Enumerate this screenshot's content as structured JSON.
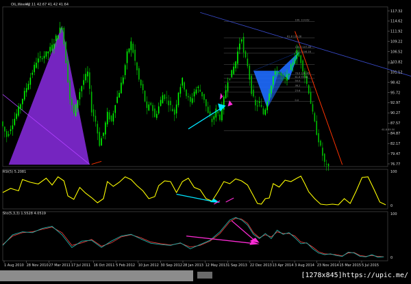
{
  "header": {
    "symbol": "OIL,Weekly",
    "ohlc": "42.11 42.67 41.42 41.64"
  },
  "colors": {
    "background": "#000000",
    "candles_up": "#00ff00",
    "candles_down": "#00c000",
    "rsi_line": "#ffff00",
    "stoch_main": "#20b2aa",
    "stoch_signal": "#ff4040",
    "pattern_blue": "#1e6bff",
    "pattern_purple": "#8a2be2",
    "arrow_cyan": "#00e5ff",
    "arrow_magenta": "#ff2bd6",
    "trend_red": "#ff3300",
    "trend_blue": "#3a4ccf"
  },
  "chart_data": [
    {
      "type": "candlestick",
      "title": "OIL,Weekly",
      "y_ticks": [
        "117.32",
        "114.62",
        "111.92",
        "109.22",
        "106.52",
        "103.82",
        "101.12",
        "98.42",
        "95.72",
        "92.97",
        "90.27",
        "87.57",
        "84.87",
        "82.17",
        "79.47",
        "76.77"
      ],
      "ylim": [
        76.0,
        118.5
      ],
      "fib_levels": [
        "100. 114.62",
        "61.8 110.28",
        "100.0 107.46",
        "127.2 106.16",
        "23.6",
        "78.6 100.46",
        "61.8 99.46",
        "50.0",
        "38.2",
        "23.6",
        "0.0",
        "61.8 85.50"
      ],
      "path_price": [
        [
          0,
          88
        ],
        [
          3,
          84
        ],
        [
          8,
          90
        ],
        [
          13,
          97
        ],
        [
          18,
          104
        ],
        [
          23,
          106
        ],
        [
          26,
          108
        ],
        [
          29,
          111.5
        ],
        [
          31,
          113.5
        ],
        [
          33,
          104
        ],
        [
          35,
          94
        ],
        [
          37,
          90
        ],
        [
          40,
          96
        ],
        [
          42,
          99
        ],
        [
          44,
          101
        ],
        [
          46,
          91
        ],
        [
          48,
          88
        ],
        [
          50,
          82
        ],
        [
          52,
          85
        ],
        [
          54,
          90
        ],
        [
          56,
          88
        ],
        [
          58,
          93
        ],
        [
          60,
          96
        ],
        [
          62,
          100
        ],
        [
          64,
          106
        ],
        [
          66,
          109
        ],
        [
          68,
          104
        ],
        [
          70,
          99
        ],
        [
          72,
          96
        ],
        [
          74,
          91
        ],
        [
          76,
          93
        ],
        [
          78,
          89
        ],
        [
          80,
          92
        ],
        [
          82,
          95
        ],
        [
          84,
          94
        ],
        [
          86,
          92
        ],
        [
          88,
          90
        ],
        [
          90,
          96
        ],
        [
          92,
          99
        ],
        [
          94,
          95
        ],
        [
          96,
          93
        ],
        [
          98,
          96
        ],
        [
          100,
          97
        ],
        [
          103,
          94
        ],
        [
          105,
          90
        ],
        [
          107,
          88
        ],
        [
          109,
          91
        ],
        [
          111,
          89
        ],
        [
          113,
          94
        ],
        [
          115,
          99
        ],
        [
          117,
          101
        ],
        [
          119,
          104
        ],
        [
          121,
          109
        ],
        [
          122,
          110.5
        ],
        [
          123,
          106
        ],
        [
          125,
          103
        ],
        [
          127,
          96
        ],
        [
          129,
          92
        ],
        [
          131,
          93
        ],
        [
          133,
          90
        ],
        [
          134,
          91.5
        ],
        [
          136,
          96
        ],
        [
          138,
          100
        ],
        [
          140,
          101.5
        ],
        [
          142,
          100
        ],
        [
          144,
          99
        ],
        [
          146,
          101
        ],
        [
          148,
          104
        ],
        [
          150,
          106.5
        ],
        [
          152,
          104
        ],
        [
          154,
          100
        ],
        [
          156,
          96
        ],
        [
          158,
          90
        ],
        [
          160,
          85
        ],
        [
          162,
          81
        ],
        [
          164,
          77
        ],
        [
          165,
          76
        ]
      ],
      "pattern_points": [
        [
          127,
          101.5
        ],
        [
          134,
          91.5
        ],
        [
          140,
          101.5
        ],
        [
          145,
          99
        ],
        [
          150,
          106.5
        ]
      ],
      "purple_polygon": [
        [
          3,
          76.5
        ],
        [
          30,
          113.5
        ],
        [
          44,
          76.5
        ]
      ],
      "red_trend": [
        [
          148,
          112
        ],
        [
          172,
          76.5
        ]
      ],
      "blue_trend": [
        [
          100,
          117
        ],
        [
          245,
          94
        ]
      ]
    },
    {
      "type": "line",
      "title": "RSI(5) 5.2081",
      "ylim": [
        0,
        100
      ],
      "y_ticks": [
        "100",
        "0"
      ],
      "series": [
        {
          "values": [
            [
              0,
              40
            ],
            [
              4,
              52
            ],
            [
              8,
              45
            ],
            [
              10,
              78
            ],
            [
              14,
              70
            ],
            [
              18,
              65
            ],
            [
              22,
              82
            ],
            [
              25,
              62
            ],
            [
              28,
              86
            ],
            [
              31,
              74
            ],
            [
              33,
              30
            ],
            [
              36,
              20
            ],
            [
              39,
              55
            ],
            [
              42,
              38
            ],
            [
              45,
              25
            ],
            [
              48,
              10
            ],
            [
              51,
              22
            ],
            [
              53,
              72
            ],
            [
              56,
              58
            ],
            [
              59,
              70
            ],
            [
              62,
              86
            ],
            [
              65,
              78
            ],
            [
              68,
              60
            ],
            [
              71,
              45
            ],
            [
              74,
              22
            ],
            [
              77,
              28
            ],
            [
              79,
              60
            ],
            [
              82,
              74
            ],
            [
              85,
              72
            ],
            [
              88,
              40
            ],
            [
              91,
              72
            ],
            [
              94,
              82
            ],
            [
              97,
              55
            ],
            [
              100,
              48
            ],
            [
              103,
              22
            ],
            [
              106,
              15
            ],
            [
              109,
              42
            ],
            [
              112,
              72
            ],
            [
              115,
              66
            ],
            [
              118,
              80
            ],
            [
              121,
              74
            ],
            [
              124,
              62
            ],
            [
              127,
              30
            ],
            [
              129,
              8
            ],
            [
              131,
              6
            ],
            [
              133,
              22
            ],
            [
              135,
              24
            ],
            [
              137,
              66
            ],
            [
              140,
              56
            ],
            [
              143,
              76
            ],
            [
              146,
              72
            ],
            [
              149,
              82
            ],
            [
              151,
              88
            ],
            [
              153,
              66
            ],
            [
              155,
              42
            ],
            [
              158,
              22
            ],
            [
              161,
              6
            ],
            [
              164,
              4
            ],
            [
              167,
              6
            ],
            [
              170,
              4
            ],
            [
              173,
              22
            ],
            [
              176,
              8
            ],
            [
              179,
              44
            ],
            [
              182,
              84
            ],
            [
              185,
              86
            ],
            [
              188,
              50
            ],
            [
              191,
              12
            ],
            [
              194,
              4
            ]
          ]
        }
      ]
    },
    {
      "type": "line",
      "title": "Sto(5,3,3) 1.5528 4.0519",
      "ylim": [
        0,
        100
      ],
      "y_ticks": [
        "100",
        "0"
      ],
      "series": [
        {
          "values": [
            [
              0,
              30
            ],
            [
              5,
              55
            ],
            [
              10,
              62
            ],
            [
              15,
              60
            ],
            [
              20,
              70
            ],
            [
              25,
              75
            ],
            [
              30,
              55
            ],
            [
              35,
              25
            ],
            [
              40,
              40
            ],
            [
              45,
              42
            ],
            [
              50,
              25
            ],
            [
              55,
              40
            ],
            [
              60,
              52
            ],
            [
              65,
              56
            ],
            [
              70,
              45
            ],
            [
              75,
              35
            ],
            [
              80,
              32
            ],
            [
              85,
              30
            ],
            [
              90,
              36
            ],
            [
              95,
              22
            ],
            [
              100,
              32
            ],
            [
              105,
              42
            ],
            [
              110,
              62
            ],
            [
              115,
              90
            ],
            [
              118,
              96
            ],
            [
              121,
              90
            ],
            [
              124,
              78
            ],
            [
              127,
              56
            ],
            [
              130,
              46
            ],
            [
              133,
              58
            ],
            [
              136,
              46
            ],
            [
              139,
              66
            ],
            [
              142,
              56
            ],
            [
              145,
              60
            ],
            [
              148,
              48
            ],
            [
              151,
              34
            ],
            [
              154,
              36
            ],
            [
              157,
              22
            ],
            [
              160,
              12
            ],
            [
              163,
              8
            ],
            [
              166,
              10
            ],
            [
              169,
              6
            ],
            [
              172,
              4
            ],
            [
              175,
              14
            ],
            [
              178,
              12
            ],
            [
              181,
              4
            ],
            [
              184,
              3
            ],
            [
              187,
              8
            ],
            [
              190,
              2
            ],
            [
              193,
              3
            ]
          ]
        },
        {
          "values": [
            [
              0,
              32
            ],
            [
              5,
              52
            ],
            [
              10,
              60
            ],
            [
              15,
              62
            ],
            [
              20,
              68
            ],
            [
              25,
              73
            ],
            [
              30,
              60
            ],
            [
              35,
              30
            ],
            [
              40,
              36
            ],
            [
              45,
              44
            ],
            [
              50,
              28
            ],
            [
              55,
              36
            ],
            [
              60,
              50
            ],
            [
              65,
              55
            ],
            [
              70,
              48
            ],
            [
              75,
              38
            ],
            [
              80,
              34
            ],
            [
              85,
              31
            ],
            [
              90,
              35
            ],
            [
              95,
              26
            ],
            [
              100,
              30
            ],
            [
              105,
              40
            ],
            [
              110,
              58
            ],
            [
              115,
              86
            ],
            [
              118,
              94
            ],
            [
              121,
              92
            ],
            [
              124,
              82
            ],
            [
              127,
              60
            ],
            [
              130,
              48
            ],
            [
              133,
              55
            ],
            [
              136,
              50
            ],
            [
              139,
              62
            ],
            [
              142,
              58
            ],
            [
              145,
              58
            ],
            [
              148,
              52
            ],
            [
              151,
              38
            ],
            [
              154,
              35
            ],
            [
              157,
              26
            ],
            [
              160,
              15
            ],
            [
              163,
              10
            ],
            [
              166,
              9
            ],
            [
              169,
              8
            ],
            [
              172,
              5
            ],
            [
              175,
              12
            ],
            [
              178,
              13
            ],
            [
              181,
              6
            ],
            [
              184,
              4
            ],
            [
              187,
              6
            ],
            [
              190,
              4
            ],
            [
              193,
              3
            ]
          ]
        }
      ]
    }
  ],
  "x_ticks": [
    "1 Aug 2010",
    "28 Nov 2010",
    "27 Mar 2011",
    "17 Jul 2011",
    "16 Oct 2011",
    "5 Feb 2012",
    "10 Jun 2012",
    "30 Sep 2012",
    "28 Jan 2013",
    "12 May 2013",
    "1 Sep 2013",
    "22 Dec 2013",
    "13 Apr 2014",
    "3 Aug 2014",
    "23 Nov 2014",
    "15 Mar 2015",
    "5 Jul 2015"
  ],
  "watermark": "[1278x845]https://upic.me/"
}
